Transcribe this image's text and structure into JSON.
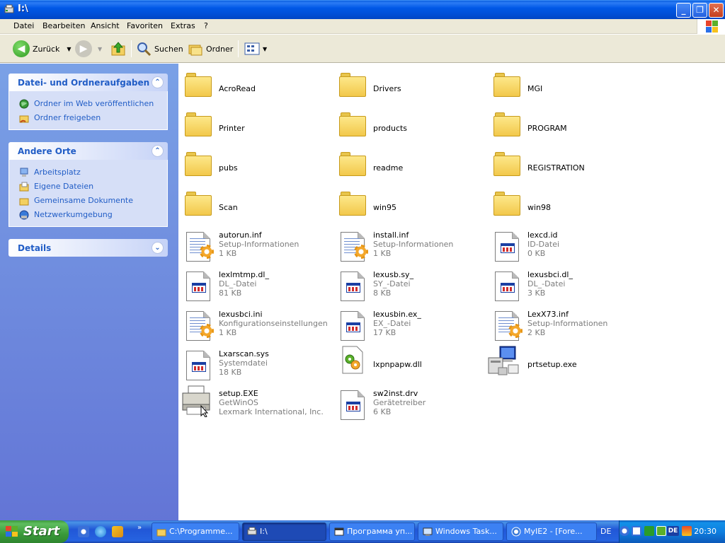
{
  "window": {
    "title": "I:\\"
  },
  "menu": [
    "Datei",
    "Bearbeiten",
    "Ansicht",
    "Favoriten",
    "Extras",
    "?"
  ],
  "toolbar": {
    "back_label": "Zurück",
    "search_label": "Suchen",
    "folders_label": "Ordner"
  },
  "sidebar": {
    "tasks": {
      "title": "Datei- und Ordneraufgaben",
      "items": [
        "Ordner im Web veröffentlichen",
        "Ordner freigeben"
      ]
    },
    "places": {
      "title": "Andere Orte",
      "items": [
        "Arbeitsplatz",
        "Eigene Dateien",
        "Gemeinsame Dokumente",
        "Netzwerkumgebung"
      ]
    },
    "details": {
      "title": "Details"
    }
  },
  "files": [
    {
      "name": "AcroRead",
      "type": "folder"
    },
    {
      "name": "Drivers",
      "type": "folder"
    },
    {
      "name": "MGI",
      "type": "folder"
    },
    {
      "name": "Printer",
      "type": "folder"
    },
    {
      "name": "products",
      "type": "folder"
    },
    {
      "name": "PROGRAM",
      "type": "folder"
    },
    {
      "name": "pubs",
      "type": "folder"
    },
    {
      "name": "readme",
      "type": "folder"
    },
    {
      "name": "REGISTRATION",
      "type": "folder"
    },
    {
      "name": "Scan",
      "type": "folder"
    },
    {
      "name": "win95",
      "type": "folder"
    },
    {
      "name": "win98",
      "type": "folder"
    },
    {
      "name": "autorun.inf",
      "line2": "Setup-Informationen",
      "line3": "1 KB",
      "type": "inf"
    },
    {
      "name": "install.inf",
      "line2": "Setup-Informationen",
      "line3": "1 KB",
      "type": "inf"
    },
    {
      "name": "lexcd.id",
      "line2": "ID-Datei",
      "line3": "0 KB",
      "type": "doc"
    },
    {
      "name": "lexlmtmp.dl_",
      "line2": "DL_-Datei",
      "line3": "81 KB",
      "type": "doc"
    },
    {
      "name": "lexusb.sy_",
      "line2": "SY_-Datei",
      "line3": "8 KB",
      "type": "doc"
    },
    {
      "name": "lexusbci.dl_",
      "line2": "DL_-Datei",
      "line3": "3 KB",
      "type": "doc"
    },
    {
      "name": "lexusbci.ini",
      "line2": "Konfigurationseinstellungen",
      "line3": "1 KB",
      "type": "inf"
    },
    {
      "name": "lexusbin.ex_",
      "line2": "EX_-Datei",
      "line3": "17 KB",
      "type": "doc"
    },
    {
      "name": "LexX73.inf",
      "line2": "Setup-Informationen",
      "line3": "2 KB",
      "type": "inf"
    },
    {
      "name": "Lxarscan.sys",
      "line2": "Systemdatei",
      "line3": "18 KB",
      "type": "doc"
    },
    {
      "name": "lxpnpapw.dll",
      "type": "dll"
    },
    {
      "name": "prtsetup.exe",
      "type": "exe"
    },
    {
      "name": "setup.EXE",
      "line2": "GetWinOS",
      "line3": "Lexmark International, Inc.",
      "type": "printer"
    },
    {
      "name": "sw2inst.drv",
      "line2": "Gerätetreiber",
      "line3": "6 KB",
      "type": "doc"
    }
  ],
  "taskbar": {
    "start_label": "Start",
    "tasks": [
      {
        "label": "C:\\Programme...",
        "active": false
      },
      {
        "label": "I:\\",
        "active": true
      },
      {
        "label": "Программа уп...",
        "active": false
      },
      {
        "label": "Windows Task...",
        "active": false
      },
      {
        "label": "MyIE2 - [Fore...",
        "active": false
      }
    ],
    "language": "DE",
    "tray_lang": "DE",
    "clock": "20:30"
  }
}
